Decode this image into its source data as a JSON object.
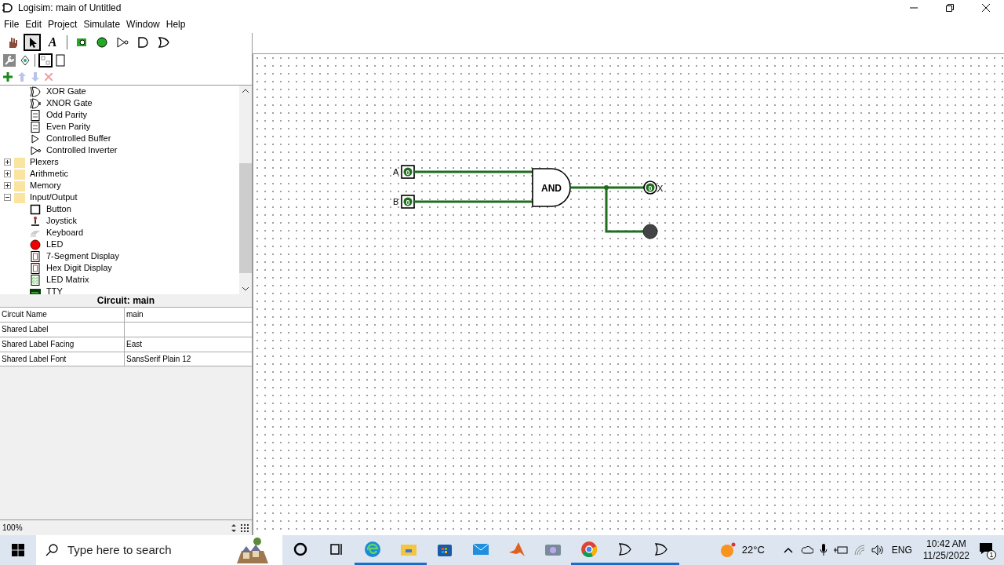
{
  "window": {
    "title": "Logisim: main of Untitled"
  },
  "menu": [
    "File",
    "Edit",
    "Project",
    "Simulate",
    "Window",
    "Help"
  ],
  "toolbar": [
    {
      "kind": "hand",
      "selected": false
    },
    {
      "kind": "arrow",
      "selected": true
    },
    {
      "kind": "text",
      "label": "A",
      "selected": false
    },
    {
      "kind": "sep"
    },
    {
      "kind": "pin-in",
      "selected": false
    },
    {
      "kind": "pin-out",
      "selected": false
    },
    {
      "kind": "not",
      "selected": false
    },
    {
      "kind": "and",
      "selected": false
    },
    {
      "kind": "or",
      "selected": false
    }
  ],
  "tree": [
    {
      "kind": "group",
      "children": [
        {
          "label": "XOR Gate",
          "kind": "xor"
        },
        {
          "label": "XNOR Gate",
          "kind": "xnor"
        },
        {
          "label": "Odd Parity",
          "kind": "parity"
        },
        {
          "label": "Even Parity",
          "kind": "parity"
        },
        {
          "label": "Controlled Buffer",
          "kind": "buffer"
        },
        {
          "label": "Controlled Inverter",
          "kind": "inverter"
        }
      ]
    },
    {
      "label": "Plexers",
      "kind": "folder",
      "expanded": false
    },
    {
      "label": "Arithmetic",
      "kind": "folder",
      "expanded": false
    },
    {
      "label": "Memory",
      "kind": "folder",
      "expanded": false
    },
    {
      "label": "Input/Output",
      "kind": "folder",
      "expanded": true,
      "children": [
        {
          "label": "Button",
          "kind": "button"
        },
        {
          "label": "Joystick",
          "kind": "joystick"
        },
        {
          "label": "Keyboard",
          "kind": "keyboard"
        },
        {
          "label": "LED",
          "kind": "led"
        },
        {
          "label": "7-Segment Display",
          "kind": "seg"
        },
        {
          "label": "Hex Digit Display",
          "kind": "seg"
        },
        {
          "label": "LED Matrix",
          "kind": "matrix"
        },
        {
          "label": "TTY",
          "kind": "tty"
        }
      ]
    }
  ],
  "properties": {
    "title": "Circuit: main",
    "rows": [
      {
        "name": "Circuit Name",
        "value": "main"
      },
      {
        "name": "Shared Label",
        "value": ""
      },
      {
        "name": "Shared Label Facing",
        "value": "East"
      },
      {
        "name": "Shared Label Font",
        "value": "SansSerif Plain 12"
      }
    ]
  },
  "zoom": "100%",
  "circuit": {
    "inputs": [
      {
        "label": "A",
        "value": "0"
      },
      {
        "label": "B",
        "value": "0"
      }
    ],
    "gate": "AND",
    "output": {
      "label": "X",
      "value": "0"
    },
    "led": {
      "on": false
    }
  },
  "taskbar": {
    "search_placeholder": "Type here to search",
    "apps": [
      {
        "kind": "cortana",
        "running": false
      },
      {
        "kind": "taskview",
        "running": false
      },
      {
        "kind": "edge",
        "running": true
      },
      {
        "kind": "explorer",
        "running": true
      },
      {
        "kind": "store",
        "running": false
      },
      {
        "kind": "mail",
        "running": false
      },
      {
        "kind": "matlab",
        "running": false
      },
      {
        "kind": "camera",
        "running": false
      },
      {
        "kind": "chrome",
        "running": true
      },
      {
        "kind": "logisim",
        "running": true
      },
      {
        "kind": "logisim",
        "running": true
      }
    ],
    "temperature": "22°C",
    "language": "ENG",
    "time": "10:42 AM",
    "date": "11/25/2022",
    "notifications": "1"
  }
}
